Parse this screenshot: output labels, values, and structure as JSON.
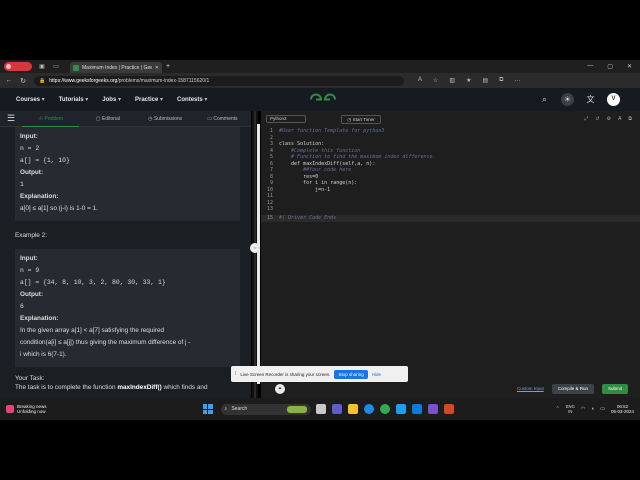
{
  "browser": {
    "tab_title": "Maximum Index | Practice | Geek",
    "url_host": "https://www.geeksforgeeks.org",
    "url_path": "/problems/maximum-index-1587115620/1",
    "new_tab": "+",
    "win_min": "—",
    "win_max": "▢",
    "win_close": "✕"
  },
  "site": {
    "logo": "GG",
    "menus": [
      "Courses",
      "Tutorials",
      "Jobs",
      "Practice",
      "Contests"
    ],
    "avatar": "V"
  },
  "left": {
    "tabs": [
      "Problem",
      "Editorial",
      "Submissions",
      "Comments"
    ],
    "example1": {
      "input_label": "Input:",
      "n": "n = 2",
      "a": "a[] = {1, 10}",
      "output_label": "Output:",
      "output": "1",
      "explanation_label": "Explanation:",
      "explanation": "a[0] ≤ a[1] so (j-i) is 1-0 = 1."
    },
    "example2_title": "Example 2:",
    "example2": {
      "input_label": "Input:",
      "n": "n = 9",
      "a": "a[] = {34, 8, 10, 3, 2, 80, 30, 33, 1}",
      "output_label": "Output:",
      "output": "6",
      "explanation_label": "Explanation:",
      "explanation_1": "In the given array a[1] < a[7]  satisfying the required",
      "explanation_2": "condition(a[i] ≤ a[j]) thus giving the maximum difference of j -",
      "explanation_3": "i which is 6(7-1)."
    },
    "task_title": "Your Task:",
    "task_prefix": "The task is to complete the function ",
    "task_fn": "maxIndexDiff()",
    "task_suffix": " which finds and"
  },
  "editor": {
    "language": "Python3",
    "timer": "Start Timer",
    "lines": [
      {
        "n": "1",
        "code": "#User function Template for python3",
        "style": "cm"
      },
      {
        "n": "2",
        "code": "",
        "style": "kw"
      },
      {
        "n": "3",
        "code": "class Solution:",
        "style": "kw"
      },
      {
        "n": "4",
        "code": "    #Complete this function",
        "style": "cm"
      },
      {
        "n": "5",
        "code": "    # Function to find the maximum index difference.",
        "style": "cm"
      },
      {
        "n": "6",
        "code": "    def maxIndexDiff(self,a, n):",
        "style": "kw"
      },
      {
        "n": "7",
        "code": "        ##Your code here",
        "style": "cm"
      },
      {
        "n": "8",
        "code": "        res=0",
        "style": "kw"
      },
      {
        "n": "9",
        "code": "        for i in range(n):",
        "style": "kw"
      },
      {
        "n": "10",
        "code": "            j=n-1",
        "style": "kw"
      },
      {
        "n": "11",
        "code": "",
        "style": "kw"
      },
      {
        "n": "12",
        "code": "",
        "style": "kw"
      },
      {
        "n": "13",
        "code": "",
        "style": "kw"
      },
      {
        "n": "15",
        "code": "#{ Driver Code Ends",
        "style": "cm"
      }
    ],
    "custom_input": "Custom Input",
    "compile_run": "Compile & Run",
    "submit": "Submit"
  },
  "share_banner": {
    "message": "Live Screen Recorder is sharing your screen.",
    "stop": "Stop sharing",
    "hide": "Hide"
  },
  "taskbar": {
    "weather_title": "Breaking news",
    "weather_sub": "Unfolding now",
    "search": "Search",
    "lang_1": "ENG",
    "lang_2": "IN",
    "time": "06:52",
    "date": "05-03-2024"
  },
  "colors": {
    "accent_green": "#2f8d46",
    "panel_bg": "#1b1f24",
    "editor_bg": "#1e1e1e"
  }
}
